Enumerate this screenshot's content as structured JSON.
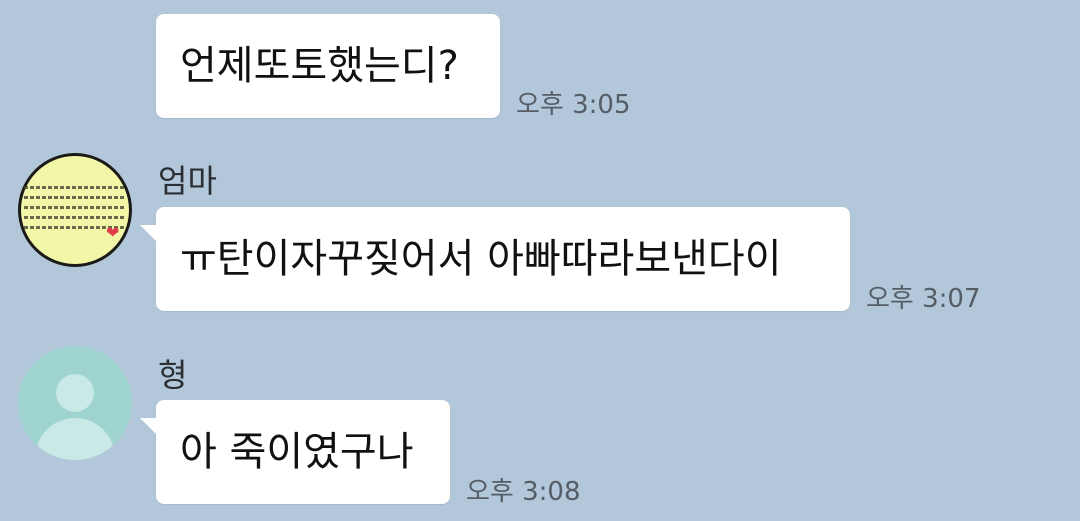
{
  "messages": [
    {
      "text": "언제또토했는디?",
      "time": "오후 3:05"
    },
    {
      "sender": "엄마",
      "avatar": "profile-photo",
      "text": "ㅠ탄이자꾸짖어서 아빠따라보낸다이",
      "time": "오후 3:07"
    },
    {
      "sender": "형",
      "avatar": "default-profile-icon",
      "text": "아 죽이였구나",
      "time": "오후 3:08"
    }
  ],
  "colors": {
    "background": "#b2c7da",
    "bubble": "#ffffff",
    "default_avatar": "#9fd3cf",
    "heart": "#e23b4a"
  }
}
